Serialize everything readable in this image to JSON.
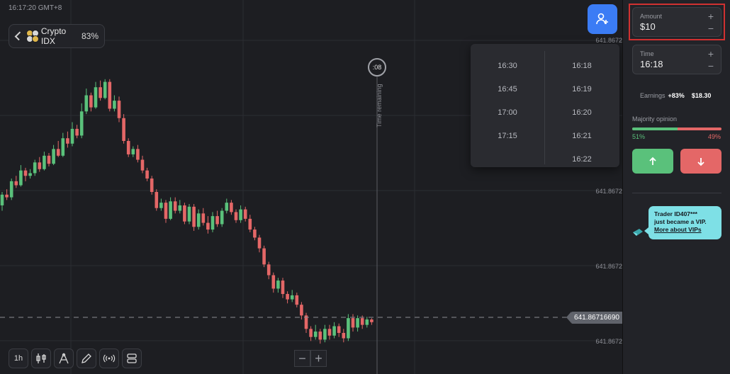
{
  "clock": "16:17:20 GMT+8",
  "asset": {
    "name": "Crypto IDX",
    "payout": "83%"
  },
  "price_axis": {
    "labels": [
      "641.8672",
      "641.8672",
      "641.8672",
      "641.8672"
    ],
    "current_price": "641.86716690"
  },
  "timer": {
    "countdown": ":08",
    "label": "Time remaining"
  },
  "time_dropdown": {
    "left_options": [
      "16:30",
      "16:45",
      "17:00",
      "17:15"
    ],
    "right_options": [
      "16:18",
      "16:19",
      "16:20",
      "16:21",
      "16:22"
    ]
  },
  "toolbar": {
    "interval_label": "1h"
  },
  "side_panel": {
    "amount": {
      "label": "Amount",
      "value": "$10"
    },
    "time": {
      "label": "Time",
      "value": "16:18"
    },
    "earnings": {
      "label": "Earnings",
      "rate": "+83%",
      "amount": "$18.30"
    },
    "majority": {
      "title": "Majority opinion",
      "up_percent": "51%",
      "down_percent": "49%",
      "up_fraction": 0.51
    },
    "vip": {
      "line1": "Trader ID407***",
      "line2": "just became a VIP.",
      "link": "More about VIPs"
    }
  },
  "colors": {
    "up": "#5ac17b",
    "down": "#e46767",
    "accent": "#3b7cf5",
    "highlight": "#d13131",
    "vip": "#7ee0e6"
  },
  "icons": {
    "asset": "crypto-coins-icon",
    "add_user": "add-user-icon",
    "candles": "candlestick-icon",
    "drawing": "drawing-tools-icon",
    "pen": "pen-icon",
    "signals": "signals-icon",
    "layout": "layout-icon",
    "up": "arrow-up-icon",
    "down": "arrow-down-icon",
    "vip": "vip-badge-icon"
  },
  "chart_data": {
    "type": "candlestick",
    "candles": [
      [
        1.6,
        2.4,
        1.2,
        2.6
      ],
      [
        2.4,
        2.2,
        2.0,
        2.8
      ],
      [
        2.2,
        3.4,
        2.0,
        3.6
      ],
      [
        3.4,
        3.1,
        2.9,
        3.8
      ],
      [
        3.1,
        4.2,
        3.0,
        4.6
      ],
      [
        4.2,
        3.8,
        3.4,
        4.4
      ],
      [
        3.8,
        4.0,
        3.6,
        4.3
      ],
      [
        4.0,
        4.8,
        3.8,
        5.0
      ],
      [
        4.8,
        4.3,
        4.1,
        5.2
      ],
      [
        4.3,
        5.3,
        4.2,
        5.6
      ],
      [
        5.3,
        4.7,
        4.5,
        5.5
      ],
      [
        4.7,
        5.8,
        4.6,
        6.1
      ],
      [
        5.8,
        5.3,
        5.2,
        6.4
      ],
      [
        5.3,
        6.6,
        5.2,
        7.0
      ],
      [
        6.6,
        6.2,
        5.9,
        7.1
      ],
      [
        6.2,
        7.3,
        6.0,
        7.8
      ],
      [
        7.3,
        6.8,
        6.6,
        7.6
      ],
      [
        6.8,
        8.6,
        6.6,
        9.2
      ],
      [
        8.6,
        9.8,
        8.4,
        10.3
      ],
      [
        9.8,
        8.9,
        8.6,
        10.0
      ],
      [
        8.9,
        10.4,
        8.8,
        10.8
      ],
      [
        10.4,
        9.6,
        9.4,
        10.9
      ],
      [
        9.6,
        10.8,
        9.5,
        11.0
      ],
      [
        10.8,
        8.8,
        8.6,
        11.0
      ],
      [
        8.8,
        9.4,
        8.6,
        9.8
      ],
      [
        9.4,
        8.1,
        7.8,
        9.7
      ],
      [
        8.1,
        6.4,
        6.2,
        8.4
      ],
      [
        6.4,
        5.4,
        5.2,
        6.6
      ],
      [
        5.4,
        5.8,
        5.2,
        6.0
      ],
      [
        5.8,
        5.0,
        4.8,
        6.1
      ],
      [
        5.0,
        4.2,
        4.0,
        5.3
      ],
      [
        4.2,
        3.6,
        3.4,
        4.4
      ],
      [
        3.6,
        2.6,
        2.4,
        3.8
      ],
      [
        2.6,
        1.4,
        1.2,
        2.8
      ],
      [
        1.4,
        1.8,
        1.2,
        2.1
      ],
      [
        1.8,
        0.6,
        0.3,
        2.0
      ],
      [
        0.6,
        1.9,
        0.5,
        2.2
      ],
      [
        1.9,
        1.2,
        1.0,
        2.2
      ],
      [
        1.2,
        1.6,
        1.0,
        2.0
      ],
      [
        1.6,
        0.4,
        0.2,
        1.8
      ],
      [
        0.4,
        1.5,
        0.2,
        1.7
      ],
      [
        1.5,
        0.0,
        -0.3,
        1.7
      ],
      [
        0.0,
        1.0,
        -0.2,
        1.3
      ],
      [
        1.0,
        0.3,
        0.1,
        1.4
      ],
      [
        0.3,
        -0.2,
        -0.5,
        0.8
      ],
      [
        -0.2,
        0.8,
        -0.4,
        1.1
      ],
      [
        0.8,
        0.2,
        0.0,
        1.2
      ],
      [
        0.2,
        1.2,
        0.0,
        1.4
      ],
      [
        1.2,
        1.8,
        1.0,
        2.1
      ],
      [
        1.8,
        1.1,
        0.9,
        2.0
      ],
      [
        1.1,
        0.5,
        0.3,
        1.3
      ],
      [
        0.5,
        1.3,
        0.3,
        1.6
      ],
      [
        1.3,
        0.6,
        0.4,
        1.5
      ],
      [
        0.6,
        -0.2,
        -0.4,
        0.9
      ],
      [
        -0.2,
        -0.8,
        -1.0,
        0.0
      ],
      [
        -0.8,
        -1.6,
        -1.9,
        -0.6
      ],
      [
        -1.6,
        -2.8,
        -3.0,
        -1.4
      ],
      [
        -2.8,
        -3.6,
        -3.9,
        -2.6
      ],
      [
        -3.6,
        -4.6,
        -4.9,
        -3.4
      ],
      [
        -4.6,
        -4.0,
        -4.9,
        -3.8
      ],
      [
        -4.0,
        -5.0,
        -5.3,
        -3.8
      ],
      [
        -5.0,
        -5.4,
        -5.7,
        -4.8
      ],
      [
        -5.4,
        -5.1,
        -5.6,
        -4.7
      ],
      [
        -5.1,
        -5.8,
        -6.0,
        -4.9
      ],
      [
        -5.8,
        -6.6,
        -6.9,
        -5.6
      ],
      [
        -6.6,
        -7.6,
        -7.9,
        -6.4
      ],
      [
        -7.6,
        -8.2,
        -8.5,
        -7.4
      ],
      [
        -8.2,
        -7.8,
        -8.4,
        -7.3
      ],
      [
        -7.8,
        -8.4,
        -8.7,
        -7.6
      ],
      [
        -8.4,
        -7.6,
        -8.6,
        -7.3
      ],
      [
        -7.6,
        -8.1,
        -8.4,
        -7.3
      ],
      [
        -8.1,
        -7.4,
        -8.3,
        -7.1
      ],
      [
        -7.4,
        -7.9,
        -8.2,
        -7.2
      ],
      [
        -7.9,
        -8.3,
        -8.6,
        -7.6
      ],
      [
        -8.3,
        -6.8,
        -8.5,
        -6.5
      ],
      [
        -6.8,
        -7.5,
        -7.8,
        -6.5
      ],
      [
        -7.5,
        -6.8,
        -7.8,
        -6.6
      ],
      [
        -6.8,
        -7.3,
        -7.6,
        -6.6
      ],
      [
        -7.3,
        -6.9,
        -7.5,
        -6.7
      ],
      [
        -6.9,
        -7.1,
        -7.3,
        -6.8
      ]
    ],
    "current_value": -7.1
  }
}
